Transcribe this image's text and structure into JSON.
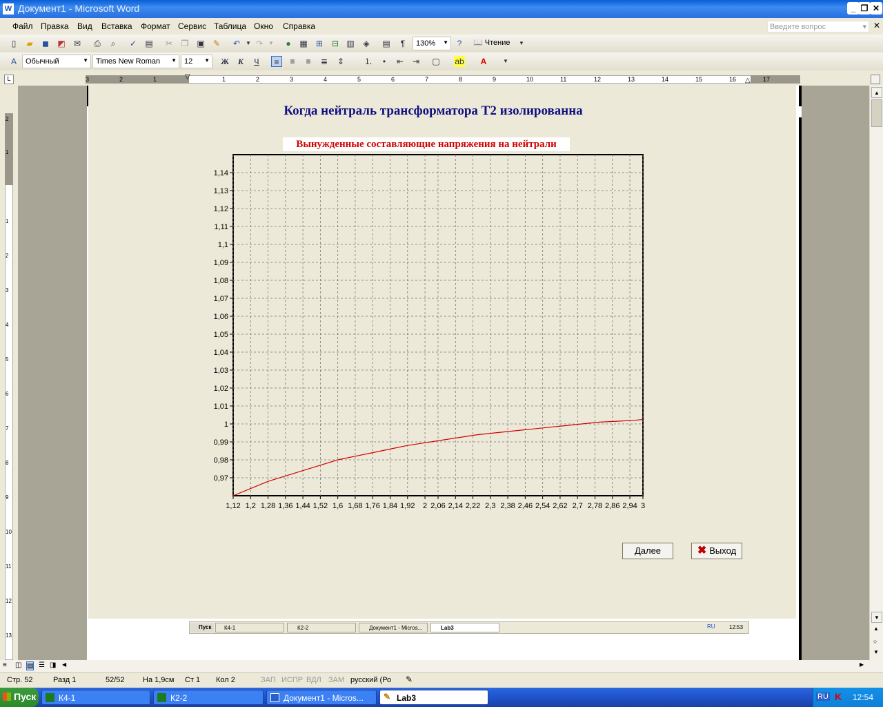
{
  "window": {
    "title": "Документ1 - Microsoft Word"
  },
  "menu": [
    "Файл",
    "Правка",
    "Вид",
    "Вставка",
    "Формат",
    "Сервис",
    "Таблица",
    "Окно",
    "Справка"
  ],
  "help_placeholder": "Введите вопрос",
  "toolbar": {
    "zoom": "130%",
    "reading": "Чтение"
  },
  "format": {
    "style": "Обычный",
    "font": "Times New Roman",
    "size": "12",
    "bold": "Ж",
    "italic": "К",
    "underline": "Ч"
  },
  "ruler": {
    "h_marks": [
      "3",
      "2",
      "1",
      "1",
      "2",
      "3",
      "4",
      "5",
      "6",
      "7",
      "8",
      "9",
      "10",
      "11",
      "12",
      "13",
      "14",
      "15",
      "16",
      "17"
    ],
    "v_marks": [
      "2",
      "1",
      "1",
      "2",
      "3",
      "4",
      "5",
      "6",
      "7",
      "8",
      "9",
      "10",
      "11",
      "12",
      "13"
    ]
  },
  "doc": {
    "heading": "Когда нейтраль трансформатора Т2 изолированна",
    "next_btn": "Далее",
    "exit_btn": "Выход"
  },
  "chart_data": {
    "type": "line",
    "title": "Вынужденные составляющие напряжения на нейтрали",
    "xlabel": "",
    "ylabel": "",
    "xlim": [
      1.12,
      3.0
    ],
    "ylim": [
      0.96,
      1.15
    ],
    "grid": true,
    "x_ticks": [
      "1,12",
      "1,2",
      "1,28",
      "1,36",
      "1,44",
      "1,52",
      "1,6",
      "1,68",
      "1,76",
      "1,84",
      "1,92",
      "2",
      "2,06",
      "2,14",
      "2,22",
      "2,3",
      "2,38",
      "2,46",
      "2,54",
      "2,62",
      "2,7",
      "2,78",
      "2,86",
      "2,94",
      "3"
    ],
    "y_ticks": [
      "1,14",
      "1,13",
      "1,12",
      "1,11",
      "1,1",
      "1,09",
      "1,08",
      "1,07",
      "1,06",
      "1,05",
      "1,04",
      "1,03",
      "1,02",
      "1,01",
      "1",
      "0,99",
      "0,98",
      "0,97"
    ],
    "series": [
      {
        "color": "#d00000",
        "x": [
          1.12,
          1.2,
          1.28,
          1.36,
          1.44,
          1.52,
          1.6,
          1.68,
          1.76,
          1.84,
          1.92,
          2.0,
          2.08,
          2.16,
          2.24,
          2.32,
          2.4,
          2.48,
          2.56,
          2.64,
          2.72,
          2.8,
          2.88,
          2.96,
          3.0
        ],
        "y": [
          0.96,
          0.964,
          0.968,
          0.971,
          0.974,
          0.977,
          0.98,
          0.982,
          0.984,
          0.986,
          0.988,
          0.9895,
          0.991,
          0.9925,
          0.994,
          0.995,
          0.996,
          0.997,
          0.998,
          0.999,
          1.0,
          1.001,
          1.0015,
          1.002,
          1.0025
        ]
      }
    ]
  },
  "inner_taskbar": {
    "start": "Пуск",
    "items": [
      "К4-1",
      "К2-2",
      "Документ1 - Micros...",
      "Lab3"
    ],
    "lang": "RU",
    "time": "12:53"
  },
  "status": {
    "page": "Стр. 52",
    "section": "Разд 1",
    "pages": "52/52",
    "at": "На 1,9см",
    "line": "Ст 1",
    "col": "Кол 2",
    "rec": "ЗАП",
    "trk": "ИСПР",
    "ext": "ВДЛ",
    "ovr": "ЗАМ",
    "lang": "русский (Ро"
  },
  "taskbar": {
    "start": "Пуск",
    "items": [
      "К4-1",
      "К2-2",
      "Документ1 - Micros...",
      "Lab3"
    ],
    "lang": "RU",
    "time": "12:54"
  }
}
